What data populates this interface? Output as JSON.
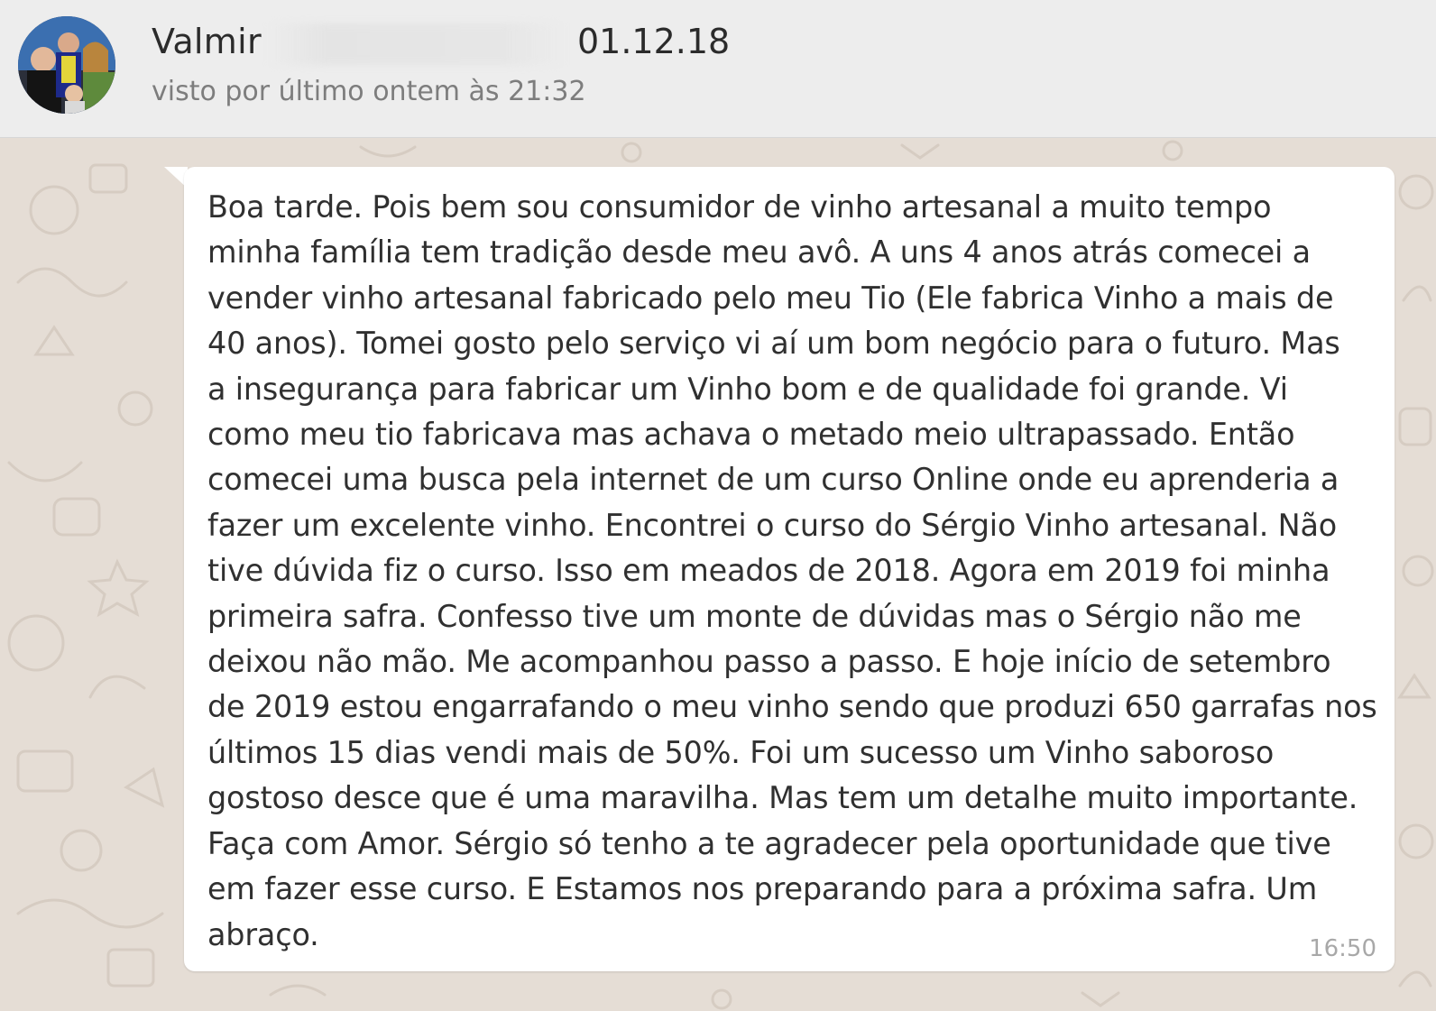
{
  "header": {
    "contact_name": "Valmir",
    "date": "01.12.18",
    "last_seen": "visto por último ontem às 21:32"
  },
  "message": {
    "text": "Boa tarde.  Pois bem sou consumidor de vinho artesanal  a muito tempo\nminha família tem tradição desde meu avô.  A uns 4 anos atrás comecei a\nvender vinho artesanal fabricado pelo meu Tio  (Ele fabrica Vinho a mais de\n40 anos). Tomei gosto pelo serviço vi aí um bom negócio para o futuro.  Mas\na insegurança para fabricar um Vinho bom e de qualidade foi grande.  Vi\ncomo meu tio fabricava mas achava o metado meio ultrapassado. Então\ncomecei uma busca pela internet de um curso Online onde eu aprenderia a\nfazer um excelente vinho. Encontrei o curso do Sérgio Vinho artesanal. Não\ntive dúvida fiz o curso.  Isso em meados de 2018. Agora em 2019 foi minha\nprimeira safra.  Confesso tive um monte de dúvidas mas o Sérgio não me\ndeixou não mão. Me acompanhou passo a passo. E hoje início de setembro\nde 2019 estou engarrafando o meu vinho sendo que produzi 650 garrafas nos\núltimos 15 dias vendi mais de 50%. Foi um sucesso um Vinho saboroso\ngostoso desce que é uma maravilha. Mas tem um detalhe muito importante.\nFaça com Amor. Sérgio só tenho a te agradecer pela oportunidade que tive\nem fazer esse curso.  E Estamos nos preparando para a próxima safra. Um\nabraço.",
    "time": "16:50"
  },
  "colors": {
    "header_bg": "#ededed",
    "chat_bg": "#e5ddd5",
    "bubble_bg": "#ffffff",
    "text": "#303030",
    "secondary_text": "#7d7d7d"
  }
}
